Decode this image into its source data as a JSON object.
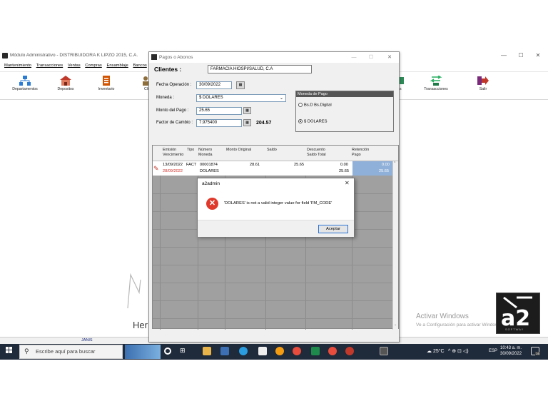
{
  "app": {
    "title": "Módulo Administrativo - DISTRIBUIDORA K LIPZO 2015, C.A.",
    "menu": [
      "Mantenimiento",
      "Transacciones",
      "Ventas",
      "Compras",
      "Ensamblaje",
      "Bancos"
    ],
    "toolbar": [
      {
        "label": "Departamentos",
        "icon": "departments-icon",
        "color": "#2a7bd4"
      },
      {
        "label": "Depositos",
        "icon": "warehouse-icon",
        "color": "#c0392b"
      },
      {
        "label": "Inventario",
        "icon": "inventory-icon",
        "color": "#d35400"
      },
      {
        "label": "Cli",
        "icon": "clients-icon",
        "color": "#8e6e3a"
      },
      {
        "label": "s",
        "icon": "partial-icon",
        "color": "#2e8b57"
      },
      {
        "label": "Transacciones",
        "icon": "transactions-icon",
        "color": "#27ae60"
      },
      {
        "label": "Salir",
        "icon": "exit-icon",
        "color": "#c0392b"
      }
    ],
    "status_user": "JANIS",
    "watermark_text": "Her",
    "activate_title": "Activar Windows",
    "activate_sub": "Ve a Configuración para activar Windows.",
    "logo_text": "a2",
    "logo_sub": "SOFTWAY"
  },
  "pagos": {
    "title": "Pagos o Abonos",
    "clientes_label": "Clientes :",
    "cliente_value": "FARMACIA HIOSPI/SALUD, C.A",
    "fecha_label": "Fecha Operación :",
    "fecha_value": "30/09/2022",
    "moneda_label": "Moneda :",
    "moneda_value": "$ DOLARES",
    "monto_label": "Monto del Pago :",
    "monto_value": "25.65",
    "factor_label": "Factor de Cambio :",
    "factor_value": "7.975400",
    "monto_total": "204.57",
    "moneda_group_title": "Moneda de Pago",
    "radio_bs": "Bs.D Bs.Digital",
    "radio_usd": "$ DOLARES",
    "grid": {
      "headers": [
        "Emisión\nVencimiento",
        "Tipo",
        "Número\nMoneda",
        "Monto Original",
        "Saldo",
        "Descuento\nSaldo Total",
        "Retención\nPago"
      ],
      "row": {
        "emision": "13/09/2022",
        "vencimiento": "28/09/2022",
        "tipo": "FACT",
        "numero": "00001874",
        "moneda": "DOLARES",
        "monto_original": "28.61",
        "saldo": "25.65",
        "descuento": "0.00",
        "saldo_total": "25.65",
        "retencion": "0.00",
        "pago": "25.65"
      }
    }
  },
  "error": {
    "title": "a2admin",
    "message": "'DOLARES' is not a valid integer value for field 'FM_CODE'",
    "ok_label": "Aceptar",
    "close": "✕"
  },
  "taskbar": {
    "search_placeholder": "Escribe aquí para buscar",
    "weather": "25°C",
    "tray": "^ ⊕ ⊡ ◁)",
    "lang": "ESP",
    "time": "10:43 a. m.",
    "date": "30/09/2022",
    "notif_count": "16"
  }
}
